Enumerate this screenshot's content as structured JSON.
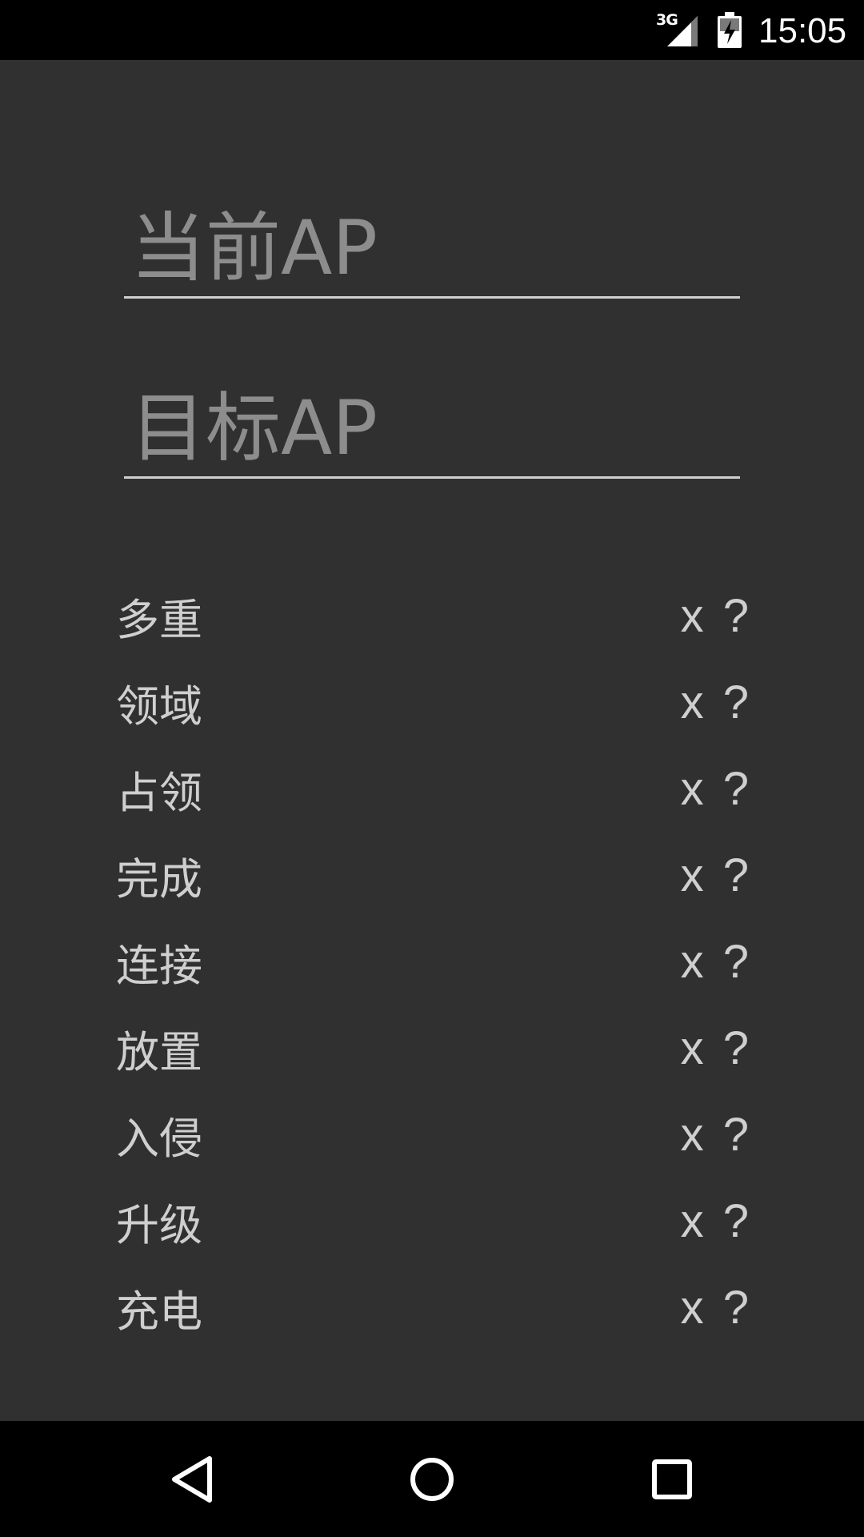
{
  "status_bar": {
    "network": "3G",
    "time": "15:05"
  },
  "form": {
    "current_ap_placeholder": "当前AP",
    "current_ap_value": "",
    "target_ap_placeholder": "目标AP",
    "target_ap_value": ""
  },
  "actions": [
    {
      "label": "多重",
      "multiplier": "x ?"
    },
    {
      "label": "领域",
      "multiplier": "x ?"
    },
    {
      "label": "占领",
      "multiplier": "x ?"
    },
    {
      "label": "完成",
      "multiplier": "x ?"
    },
    {
      "label": "连接",
      "multiplier": "x ?"
    },
    {
      "label": "放置",
      "multiplier": "x ?"
    },
    {
      "label": "入侵",
      "multiplier": "x ?"
    },
    {
      "label": "升级",
      "multiplier": "x ?"
    },
    {
      "label": "充电",
      "multiplier": "x ?"
    }
  ],
  "nav_bar": {
    "back_icon": "back-triangle-icon",
    "home_icon": "home-circle-icon",
    "recent_icon": "recent-square-icon"
  },
  "colors": {
    "background": "#303030",
    "bars": "#000000",
    "text": "#cfcfcf",
    "placeholder": "#8d8d8d"
  }
}
